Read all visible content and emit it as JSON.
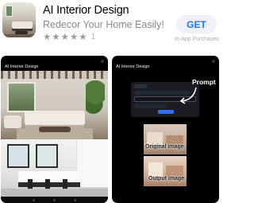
{
  "app": {
    "name": "AI Interior Design",
    "subtitle": "Redecor Your Home Easily!",
    "rating_stars": [
      "★",
      "★",
      "★",
      "★",
      "★"
    ],
    "rating_count": "1",
    "get_label": "GET",
    "in_app_purchases": "In-App Purchases",
    "icon": "app-icon-living-room"
  },
  "colors": {
    "get_text": "#1c74ff",
    "get_bg": "#eef1f7",
    "subtitle": "#8a8a8e",
    "screenshot_bg": "#000000"
  },
  "screenshots": [
    {
      "title": "AI Interior Design"
    },
    {
      "title": "AI Interior Design",
      "prompt_label": "Prompt",
      "original_caption": "Original image",
      "output_caption": "Output image"
    }
  ]
}
